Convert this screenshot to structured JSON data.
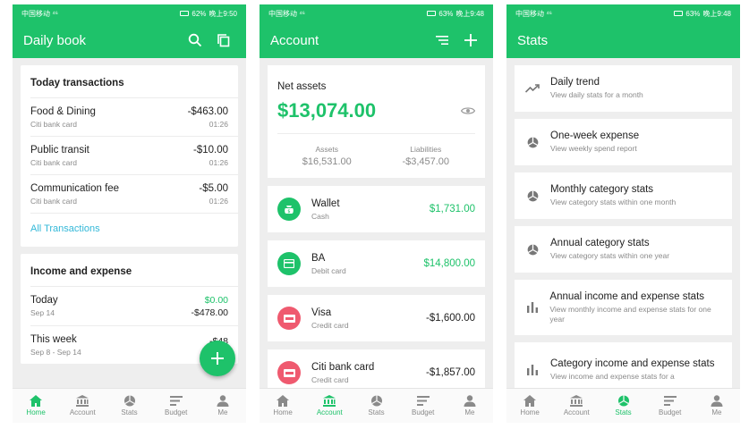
{
  "status": {
    "carrier": "中国移动",
    "signal": "⁴⁶",
    "screens": [
      {
        "battery": "62%",
        "time": "晚上9:50"
      },
      {
        "battery": "63%",
        "time": "晚上9:48"
      },
      {
        "battery": "63%",
        "time": "晚上9:48"
      }
    ]
  },
  "colors": {
    "accent": "#1ec26a",
    "link": "#33b8d8"
  },
  "nav": [
    "Home",
    "Account",
    "Stats",
    "Budget",
    "Me"
  ],
  "home": {
    "title": "Daily book",
    "today": {
      "heading": "Today transactions",
      "rows": [
        {
          "name": "Food & Dining",
          "sub": "Citi bank card",
          "amount": "-$463.00",
          "time": "01:26"
        },
        {
          "name": "Public transit",
          "sub": "Citi bank card",
          "amount": "-$10.00",
          "time": "01:26"
        },
        {
          "name": "Communication fee",
          "sub": "Citi bank card",
          "amount": "-$5.00",
          "time": "01:26"
        }
      ],
      "link": "All Transactions"
    },
    "ie": {
      "heading": "Income and expense",
      "rows": [
        {
          "name": "Today",
          "sub": "Sep 14",
          "income": "$0.00",
          "expense": "-$478.00"
        },
        {
          "name": "This week",
          "sub": "Sep 8 - Sep 14",
          "income": "",
          "expense": "-$48"
        }
      ]
    }
  },
  "account": {
    "title": "Account",
    "net_label": "Net assets",
    "net_value": "$13,074.00",
    "assets_label": "Assets",
    "assets_value": "$16,531.00",
    "liab_label": "Liabilities",
    "liab_value": "-$3,457.00",
    "items": [
      {
        "name": "Wallet",
        "sub": "Cash",
        "amount": "$1,731.00",
        "icon": "wallet-icon",
        "color": "#1ec26a"
      },
      {
        "name": "BA",
        "sub": "Debit card",
        "amount": "$14,800.00",
        "icon": "debit-card-icon",
        "color": "#1ec26a"
      },
      {
        "name": "Visa",
        "sub": "Credit card",
        "amount": "-$1,600.00",
        "icon": "visa-card-icon",
        "color": "#ef5a6f"
      },
      {
        "name": "Citi bank card",
        "sub": "Credit card",
        "amount": "-$1,857.00",
        "icon": "credit-card-icon",
        "color": "#ef5a6f"
      }
    ]
  },
  "stats": {
    "title": "Stats",
    "items": [
      {
        "name": "Daily trend",
        "sub": "View daily stats for a month",
        "icon": "trend-icon"
      },
      {
        "name": "One-week expense",
        "sub": "View weekly spend report",
        "icon": "pie-icon"
      },
      {
        "name": "Monthly category stats",
        "sub": "View category stats within one month",
        "icon": "pie-icon"
      },
      {
        "name": "Annual category stats",
        "sub": "View category stats within one year",
        "icon": "pie-icon"
      },
      {
        "name": "Annual income and expense stats",
        "sub": "View monthly income and expense stats for one year",
        "icon": "bar-chart-icon"
      },
      {
        "name": "Category income and expense stats",
        "sub": "View income and expense stats for a",
        "icon": "bar-chart-icon"
      }
    ]
  }
}
